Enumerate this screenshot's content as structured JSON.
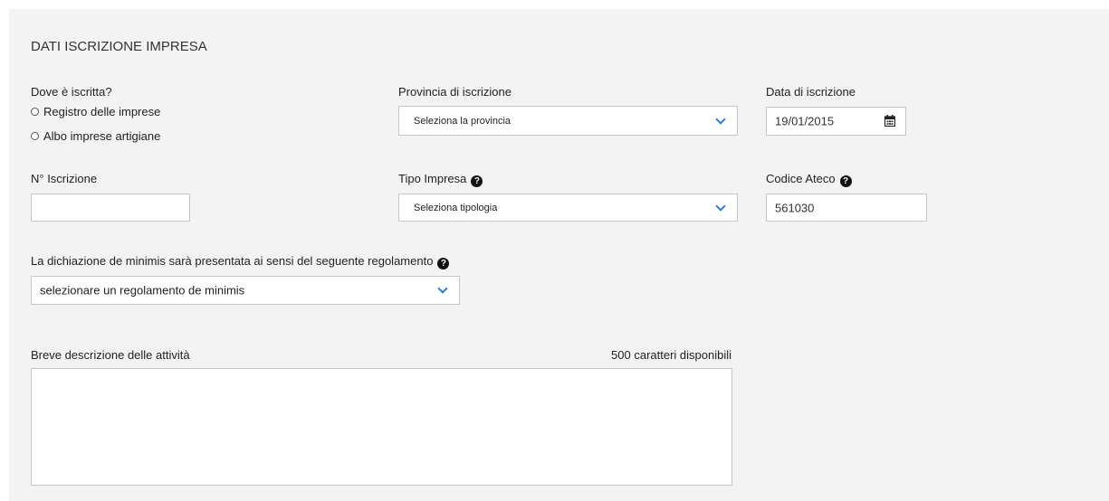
{
  "section": {
    "title": "DATI ISCRIZIONE IMPRESA"
  },
  "registry": {
    "label": "Dove è iscritta?",
    "options": [
      "Registro delle imprese",
      "Albo imprese artigiane"
    ]
  },
  "provincia": {
    "label": "Provincia di iscrizione",
    "selected": "Seleziona la provincia"
  },
  "data_iscrizione": {
    "label": "Data di iscrizione",
    "value": "19/01/2015"
  },
  "numero_iscrizione": {
    "label": "N° Iscrizione",
    "value": ""
  },
  "tipo_impresa": {
    "label": "Tipo Impresa",
    "selected": "Seleziona tipologia"
  },
  "codice_ateco": {
    "label": "Codice Ateco",
    "value": "561030"
  },
  "de_minimis": {
    "label": "La dichiazione de minimis sarà presentata ai sensi del seguente regolamento",
    "selected": "selezionare un regolamento de minimis"
  },
  "descrizione": {
    "label": "Breve descrizione delle attività",
    "counter": "500 caratteri disponibili",
    "value": ""
  },
  "icons": {
    "help": "question-circle-icon",
    "calendar": "calendar-icon",
    "dropdown": "chevron-down-icon"
  },
  "colors": {
    "panel_bg": "#f3f3f3",
    "accent": "#2a7ec7",
    "border": "#c6c6c6"
  }
}
